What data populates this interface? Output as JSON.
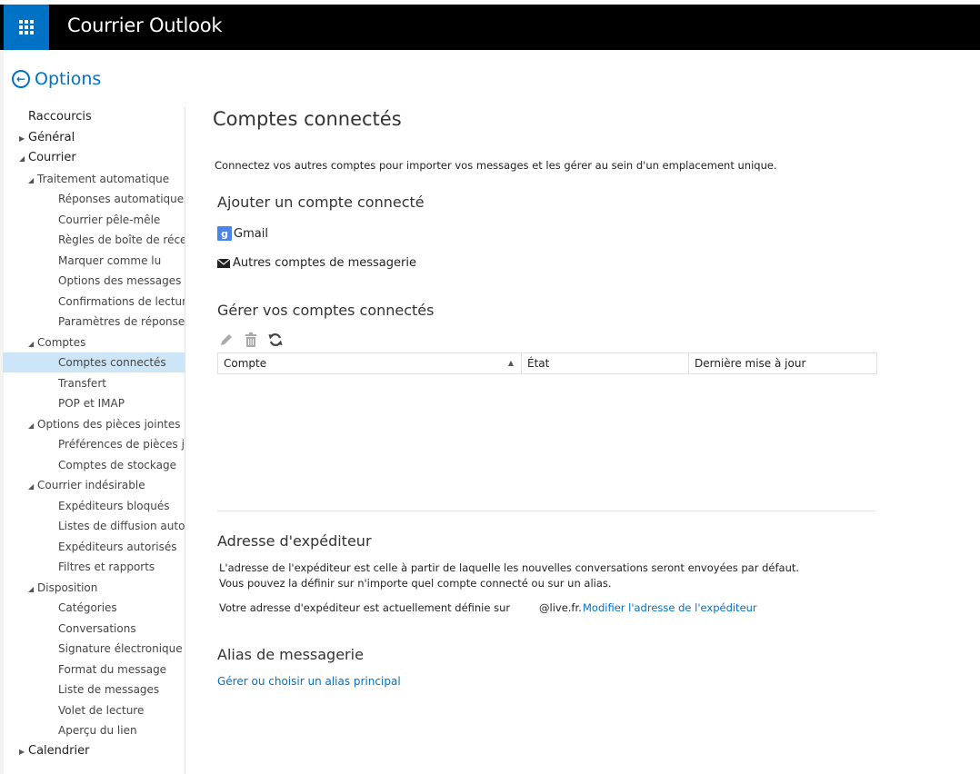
{
  "header": {
    "title": "Courrier Outlook",
    "app_launcher_icon": "waffle-grid-icon"
  },
  "back": {
    "label": "Options",
    "icon": "back-arrow-circle-icon"
  },
  "nav": [
    {
      "label": "Raccourcis",
      "level": 0,
      "arrow": ""
    },
    {
      "label": "Général",
      "level": 0,
      "arrow": "▶"
    },
    {
      "label": "Courrier",
      "level": 0,
      "arrow": "◢"
    },
    {
      "label": "Traitement automatique",
      "level": 1,
      "arrow": "◢"
    },
    {
      "label": "Réponses automatiques",
      "level": 2,
      "arrow": ""
    },
    {
      "label": "Courrier pêle-mêle",
      "level": 2,
      "arrow": ""
    },
    {
      "label": "Règles de boîte de réception",
      "level": 2,
      "arrow": ""
    },
    {
      "label": "Marquer comme lu",
      "level": 2,
      "arrow": ""
    },
    {
      "label": "Options des messages",
      "level": 2,
      "arrow": ""
    },
    {
      "label": "Confirmations de lecture",
      "level": 2,
      "arrow": ""
    },
    {
      "label": "Paramètres de réponse",
      "level": 2,
      "arrow": ""
    },
    {
      "label": "Comptes",
      "level": 1,
      "arrow": "◢"
    },
    {
      "label": "Comptes connectés",
      "level": 2,
      "arrow": "",
      "selected": true
    },
    {
      "label": "Transfert",
      "level": 2,
      "arrow": ""
    },
    {
      "label": "POP et IMAP",
      "level": 2,
      "arrow": ""
    },
    {
      "label": "Options des pièces jointes",
      "level": 1,
      "arrow": "◢"
    },
    {
      "label": "Préférences de pièces jointes",
      "level": 2,
      "arrow": ""
    },
    {
      "label": "Comptes de stockage",
      "level": 2,
      "arrow": ""
    },
    {
      "label": "Courrier indésirable",
      "level": 1,
      "arrow": "◢"
    },
    {
      "label": "Expéditeurs bloqués",
      "level": 2,
      "arrow": ""
    },
    {
      "label": "Listes de diffusion autorisées",
      "level": 2,
      "arrow": ""
    },
    {
      "label": "Expéditeurs autorisés",
      "level": 2,
      "arrow": ""
    },
    {
      "label": "Filtres et rapports",
      "level": 2,
      "arrow": ""
    },
    {
      "label": "Disposition",
      "level": 1,
      "arrow": "◢"
    },
    {
      "label": "Catégories",
      "level": 2,
      "arrow": ""
    },
    {
      "label": "Conversations",
      "level": 2,
      "arrow": ""
    },
    {
      "label": "Signature électronique",
      "level": 2,
      "arrow": ""
    },
    {
      "label": "Format du message",
      "level": 2,
      "arrow": ""
    },
    {
      "label": "Liste de messages",
      "level": 2,
      "arrow": ""
    },
    {
      "label": "Volet de lecture",
      "level": 2,
      "arrow": ""
    },
    {
      "label": "Aperçu du lien",
      "level": 2,
      "arrow": ""
    },
    {
      "label": "Calendrier",
      "level": 0,
      "arrow": "▶"
    }
  ],
  "page": {
    "title": "Comptes connectés",
    "intro": "Connectez vos autres comptes pour importer vos messages et les gérer au sein d'un emplacement unique.",
    "add_section": {
      "heading": "Ajouter un compte connecté",
      "gmail_icon_letter": "g",
      "gmail_label": "Gmail",
      "other_label": "Autres comptes de messagerie"
    },
    "manage_section": {
      "heading": "Gérer vos comptes connectés",
      "tools": [
        "edit-pencil-icon",
        "delete-trash-icon",
        "refresh-icon"
      ],
      "columns": [
        "Compte",
        "État",
        "Dernière mise à jour"
      ],
      "sort_indicator": "▲"
    },
    "sender_section": {
      "heading": "Adresse d'expéditeur",
      "description": "L'adresse de l'expéditeur est celle à partir de laquelle les nouvelles conversations seront envoyées par défaut. Vous pouvez la définir sur n'importe quel compte connecté ou sur un alias.",
      "current_label": "Votre adresse d'expéditeur est actuellement définie sur",
      "current_domain": "@live.fr.",
      "change_link": "Modifier l'adresse de l'expéditeur"
    },
    "alias_section": {
      "heading": "Alias de messagerie",
      "link": "Gérer ou choisir un alias principal"
    }
  },
  "colors": {
    "brand": "#0072c6",
    "header_bg": "#000000",
    "selected_bg": "#cde6f7"
  }
}
